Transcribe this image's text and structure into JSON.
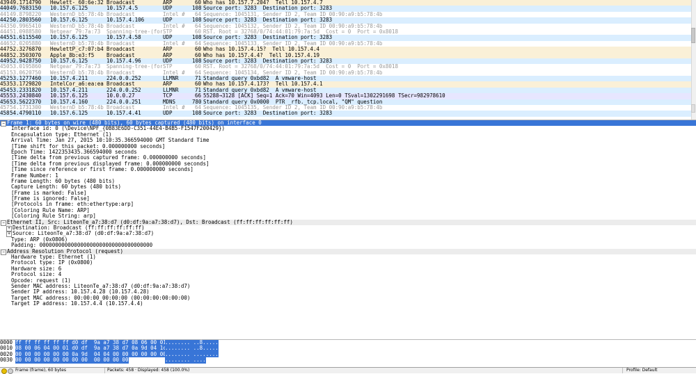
{
  "colors": {
    "arp": "#faf0d7",
    "udp": "#daeeff",
    "stp": "#ffffff",
    "lldp": "#ffffff",
    "tcp": "#e7e6ff",
    "selection": "#3875d7"
  },
  "packets": [
    {
      "no": "439",
      "time": "49.1714790",
      "src": "Hewlett-_60:6e:32",
      "dst": "Broadcast",
      "proto": "ARP",
      "len": "60",
      "info": "Who has 10.157.7.204?  Tell 10.157.4.7",
      "kind": "arp"
    },
    {
      "no": "440",
      "time": "49.7683150",
      "src": "10.157.6.125",
      "dst": "10.157.4.5",
      "proto": "UDP",
      "len": "108",
      "info": "Source port: 3283  Destination port: 3283",
      "kind": "udp"
    },
    {
      "no": "441",
      "time": "49.8798220",
      "src": "WesternD_b5:78:4b",
      "dst": "Broadcast",
      "proto": "Intel #",
      "len": "64",
      "info": "Sequence: 1045131, Sender ID 2, Team ID 00:90:a9:b5:78:4b",
      "kind": "dim"
    },
    {
      "no": "442",
      "time": "50.2803560",
      "src": "10.157.6.125",
      "dst": "10.157.4.106",
      "proto": "UDP",
      "len": "108",
      "info": "Source port: 3283  Destination port: 3283",
      "kind": "udp"
    },
    {
      "no": "443",
      "time": "50.9965410",
      "src": "WesternD_b5:78:4b",
      "dst": "Broadcast",
      "proto": "Intel #",
      "len": "64",
      "info": "Sequence: 1045132, Sender ID 2, Team ID 00:90:a9:b5:78:4b",
      "kind": "dim"
    },
    {
      "no": "444",
      "time": "51.0988580",
      "src": "Netgear_79:7a:73",
      "dst": "Spanning-tree-(for-STP",
      "proto": "STP",
      "len": "60",
      "info": "RST. Root = 32768/0/74:44:01:79:7a:5d  Cost = 0  Port = 0x8018",
      "kind": "dim"
    },
    {
      "no": "445",
      "time": "51.6115540",
      "src": "10.157.6.125",
      "dst": "10.157.4.58",
      "proto": "UDP",
      "len": "108",
      "info": "Source port: 3283  Destination port: 3283",
      "kind": "udp"
    },
    {
      "no": "446",
      "time": "52.0205880",
      "src": "WesternD_b5:78:4b",
      "dst": "Broadcast",
      "proto": "Intel #",
      "len": "64",
      "info": "Sequence: 1045133, Sender ID 2, Team ID 00:90:a9:b5:78:4b",
      "kind": "dim"
    },
    {
      "no": "447",
      "time": "52.3276870",
      "src": "HewlettP_c7:07:b4",
      "dst": "Broadcast",
      "proto": "ARP",
      "len": "60",
      "info": "Who has 10.157.4.15?  Tell 10.157.4.4",
      "kind": "arp"
    },
    {
      "no": "448",
      "time": "52.3503070",
      "src": "Apple_8b:e3:f5",
      "dst": "Broadcast",
      "proto": "ARP",
      "len": "60",
      "info": "Who has 10.157.4.4?  Tell 10.157.4.19",
      "kind": "arp"
    },
    {
      "no": "449",
      "time": "52.9428750",
      "src": "10.157.6.125",
      "dst": "10.157.4.96",
      "proto": "UDP",
      "len": "108",
      "info": "Source port: 3283  Destination port: 3283",
      "kind": "udp"
    },
    {
      "no": "450",
      "time": "53.0195860",
      "src": "Netgear_79:7a:73",
      "dst": "Spanning-tree-(for-STP",
      "proto": "STP",
      "len": "60",
      "info": "RST. Root = 32768/0/74:44:01:79:7a:5d  Cost = 0  Port = 0x8018",
      "kind": "dim"
    },
    {
      "no": "451",
      "time": "53.0620750",
      "src": "WesternD_b5:78:4b",
      "dst": "Broadcast",
      "proto": "Intel #",
      "len": "64",
      "info": "Sequence: 1045134, Sender ID 2, Team ID 00:90:a9:b5:78:4b",
      "kind": "dim"
    },
    {
      "no": "452",
      "time": "53.1277460",
      "src": "10.157.4.211",
      "dst": "224.0.0.252",
      "proto": "LLMNR",
      "len": "71",
      "info": "Standard query 0xbd82  A vmware-host",
      "kind": "llmnr"
    },
    {
      "no": "453",
      "time": "53.1729820",
      "src": "IntelCor_a6:ea:ea",
      "dst": "Broadcast",
      "proto": "ARP",
      "len": "60",
      "info": "Who has 10.157.4.173?  Tell 10.157.4.1",
      "kind": "arp"
    },
    {
      "no": "454",
      "time": "53.2331820",
      "src": "10.157.4.211",
      "dst": "224.0.0.252",
      "proto": "LLMNR",
      "len": "71",
      "info": "Standard query 0xbd82  A vmware-host",
      "kind": "llmnr"
    },
    {
      "no": "455",
      "time": "53.2430840",
      "src": "10.157.6.125",
      "dst": "10.0.0.27",
      "proto": "TCP",
      "len": "66",
      "info": "55288→3128 [ACK] Seq=1 Ack=70 Win=4093 Len=0 TSval=1302291698 TSecr=982978610",
      "kind": "tcp"
    },
    {
      "no": "456",
      "time": "53.5622370",
      "src": "10.157.4.160",
      "dst": "224.0.0.251",
      "proto": "MDNS",
      "len": "780",
      "info": "Standard query 0x0000  PTR _rfb._tcp.local, \"QM\" question",
      "kind": "mdns"
    },
    {
      "no": "457",
      "time": "54.1731300",
      "src": "WesternD_b5:78:4b",
      "dst": "Broadcast",
      "proto": "Intel #",
      "len": "64",
      "info": "Sequence: 1045135, Sender ID 2, Team ID 00:90:a9:b5:78:4b",
      "kind": "dim"
    },
    {
      "no": "458",
      "time": "54.4790110",
      "src": "10.157.6.125",
      "dst": "10.157.4.41",
      "proto": "UDP",
      "len": "108",
      "info": "Source port: 3283  Destination port: 3283",
      "kind": "udp"
    }
  ],
  "details": [
    {
      "indent": 0,
      "toggle": "⊟",
      "text": "Frame 1: 60 bytes on wire (480 bits), 60 bytes captured (480 bits) on interface 0",
      "style": "selected"
    },
    {
      "indent": 1,
      "text": "Interface id: 0 (\\Device\\NPF_{0B83E6DD-C351-44E4-B4B5-F1547F200429})"
    },
    {
      "indent": 1,
      "text": "Encapsulation type: Ethernet (1)"
    },
    {
      "indent": 1,
      "text": "Arrival Time: Jan 27, 2015 10:10:35.366594000 GMT Standard Time"
    },
    {
      "indent": 1,
      "text": "[Time shift for this packet: 0.000000000 seconds]"
    },
    {
      "indent": 1,
      "text": "Epoch Time: 1422353435.366594000 seconds"
    },
    {
      "indent": 1,
      "text": "[Time delta from previous captured frame: 0.000000000 seconds]"
    },
    {
      "indent": 1,
      "text": "[Time delta from previous displayed frame: 0.000000000 seconds]"
    },
    {
      "indent": 1,
      "text": "[Time since reference or first frame: 0.000000000 seconds]"
    },
    {
      "indent": 1,
      "text": "Frame Number: 1"
    },
    {
      "indent": 1,
      "text": "Frame Length: 60 bytes (480 bits)"
    },
    {
      "indent": 1,
      "text": "Capture Length: 60 bytes (480 bits)"
    },
    {
      "indent": 1,
      "text": "[Frame is marked: False]"
    },
    {
      "indent": 1,
      "text": "[Frame is ignored: False]"
    },
    {
      "indent": 1,
      "text": "[Protocols in frame: eth:ethertype:arp]"
    },
    {
      "indent": 1,
      "text": "[Coloring Rule Name: ARP]"
    },
    {
      "indent": 1,
      "text": "[Coloring Rule String: arp]"
    },
    {
      "indent": 0,
      "toggle": "⊟",
      "text": "Ethernet II, Src: LiteonTe_a7:38:d7 (d0:df:9a:a7:38:d7), Dst: Broadcast (ff:ff:ff:ff:ff:ff)",
      "style": "header"
    },
    {
      "indent": 1,
      "toggle": "⊞",
      "text": "Destination: Broadcast (ff:ff:ff:ff:ff:ff)"
    },
    {
      "indent": 1,
      "toggle": "⊞",
      "text": "Source: LiteonTe_a7:38:d7 (d0:df:9a:a7:38:d7)"
    },
    {
      "indent": 1,
      "text": "Type: ARP (0x0806)"
    },
    {
      "indent": 1,
      "text": "Padding: 000000000000000000000000000000000000"
    },
    {
      "indent": 0,
      "toggle": "⊟",
      "text": "Address Resolution Protocol (request)",
      "style": "header"
    },
    {
      "indent": 1,
      "text": "Hardware type: Ethernet (1)"
    },
    {
      "indent": 1,
      "text": "Protocol type: IP (0x0800)"
    },
    {
      "indent": 1,
      "text": "Hardware size: 6"
    },
    {
      "indent": 1,
      "text": "Protocol size: 4"
    },
    {
      "indent": 1,
      "text": "Opcode: request (1)"
    },
    {
      "indent": 1,
      "text": "Sender MAC address: LiteonTe_a7:38:d7 (d0:df:9a:a7:38:d7)"
    },
    {
      "indent": 1,
      "text": "Sender IP address: 10.157.4.28 (10.157.4.28)"
    },
    {
      "indent": 1,
      "text": "Target MAC address: 00:00:00_00:00:00 (00:00:00:00:00:00)"
    },
    {
      "indent": 1,
      "text": "Target IP address: 10.157.4.4 (10.157.4.4)"
    }
  ],
  "hex": [
    {
      "offset": "0000",
      "bytes": "ff ff ff ff ff ff d0 df  9a a7 38 d7 08 06 00 01",
      "ascii": "........ ..8....."
    },
    {
      "offset": "0010",
      "bytes": "08 00 06 04 00 01 d0 df  9a a7 38 d7 0a 9d 04 1c",
      "ascii": "........ ..8....."
    },
    {
      "offset": "0020",
      "bytes": "00 00 00 00 00 00 0a 9d  04 04 00 00 00 00 00 00",
      "ascii": "........ ........"
    },
    {
      "offset": "0030",
      "bytes": "00 00 00 00 00 00 00 00  00 00 00 00",
      "ascii": "........ ...."
    }
  ],
  "status": {
    "frame": "Frame (frame), 60 bytes",
    "packets": "Packets: 458 · Displayed: 458 (100.0%)",
    "profile": "Profile: Default"
  }
}
